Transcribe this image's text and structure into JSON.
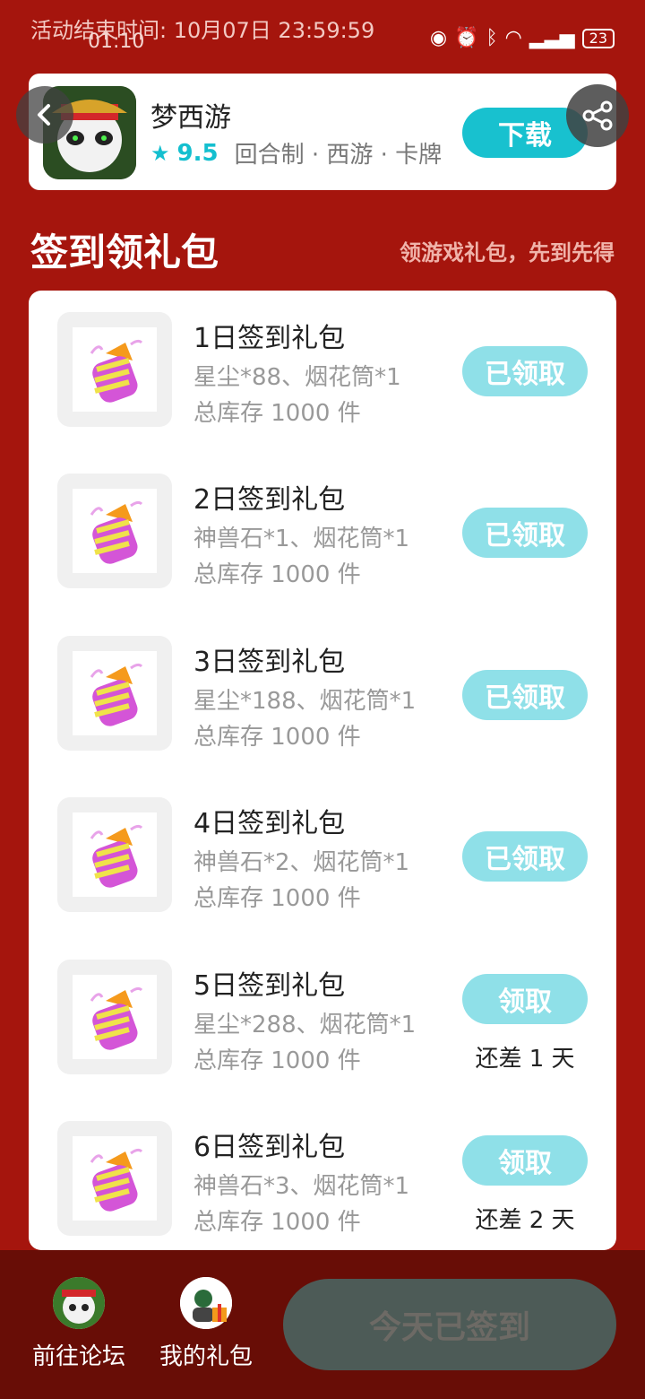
{
  "top_notice": "活动结束时间: 10月07日 23:59:59",
  "status_bar": {
    "time": "01:10",
    "battery": "23"
  },
  "game": {
    "name": "梦西游",
    "rating": "9.5",
    "tags": "回合制 · 西游 · 卡牌",
    "download_label": "下载"
  },
  "section": {
    "title": "签到领礼包",
    "subtitle": "领游戏礼包，先到先得"
  },
  "gifts": [
    {
      "title": "1日签到礼包",
      "desc": "星尘*88、烟花筒*1",
      "stock": "总库存 1000 件",
      "button": "已领取",
      "note": ""
    },
    {
      "title": "2日签到礼包",
      "desc": "神兽石*1、烟花筒*1",
      "stock": "总库存 1000 件",
      "button": "已领取",
      "note": ""
    },
    {
      "title": "3日签到礼包",
      "desc": "星尘*188、烟花筒*1",
      "stock": "总库存 1000 件",
      "button": "已领取",
      "note": ""
    },
    {
      "title": "4日签到礼包",
      "desc": "神兽石*2、烟花筒*1",
      "stock": "总库存 1000 件",
      "button": "已领取",
      "note": ""
    },
    {
      "title": "5日签到礼包",
      "desc": "星尘*288、烟花筒*1",
      "stock": "总库存 1000 件",
      "button": "领取",
      "note": "还差 1 天"
    },
    {
      "title": "6日签到礼包",
      "desc": "神兽石*3、烟花筒*1",
      "stock": "总库存 1000 件",
      "button": "领取",
      "note": "还差 2 天"
    }
  ],
  "bottom": {
    "forum_label": "前往论坛",
    "my_gifts_label": "我的礼包",
    "signed_label": "今天已签到"
  }
}
